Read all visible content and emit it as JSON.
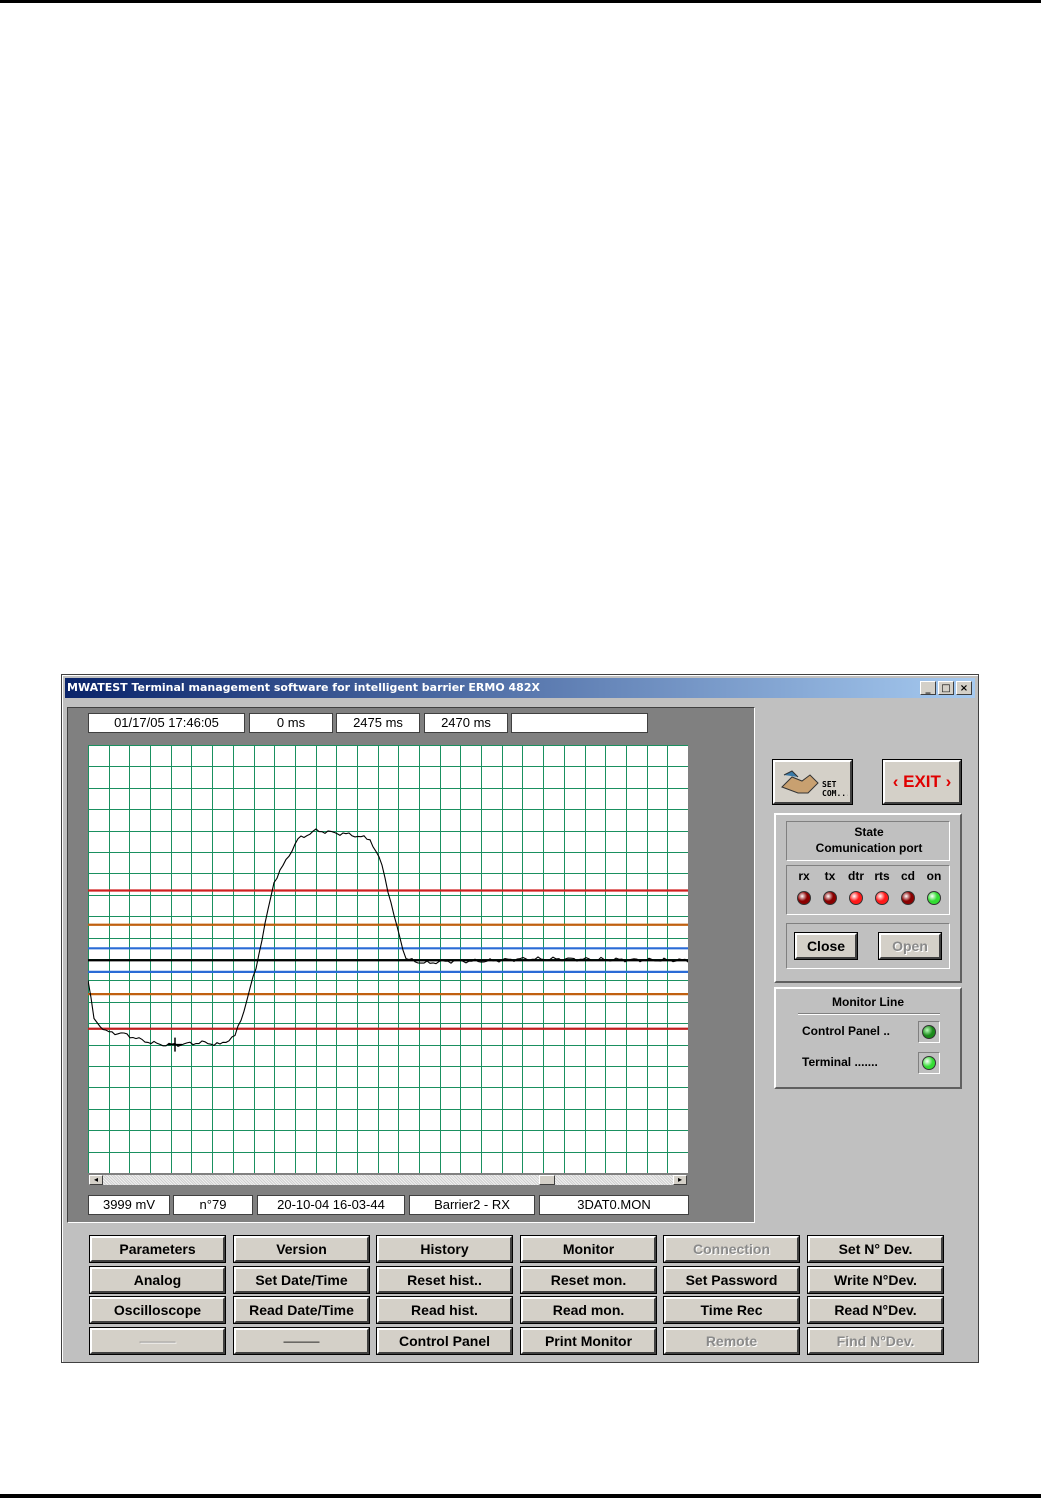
{
  "window": {
    "title": "MWATEST Terminal management software for intelligent barrier ERMO 482X",
    "controls": {
      "minimize": "_",
      "maximize": "□",
      "close": "×"
    }
  },
  "scope": {
    "top_fields": [
      "01/17/05 17:46:05",
      "0 ms",
      "2475 ms",
      "2470 ms",
      ""
    ],
    "bottom_fields": [
      "3999 mV",
      "n°79",
      "20-10-04 16-03-44",
      "Barrier2 - RX",
      "3DAT0.MON"
    ]
  },
  "chart_data": {
    "type": "line",
    "grid": true,
    "reference_lines": [
      {
        "color": "#d02020",
        "level": 0.66
      },
      {
        "color": "#c06010",
        "level": 0.58
      },
      {
        "color": "#2a6bd6",
        "level": 0.525
      },
      {
        "color": "#000000",
        "level": 0.497
      },
      {
        "color": "#2a6bd6",
        "level": 0.47
      },
      {
        "color": "#c06010",
        "level": 0.418
      },
      {
        "color": "#c02020",
        "level": 0.337
      }
    ],
    "signal": {
      "color": "#000000",
      "points": [
        [
          0.0,
          0.45
        ],
        [
          0.01,
          0.36
        ],
        [
          0.03,
          0.33
        ],
        [
          0.06,
          0.325
        ],
        [
          0.09,
          0.31
        ],
        [
          0.12,
          0.3
        ],
        [
          0.15,
          0.3
        ],
        [
          0.19,
          0.305
        ],
        [
          0.22,
          0.3
        ],
        [
          0.245,
          0.32
        ],
        [
          0.26,
          0.38
        ],
        [
          0.28,
          0.48
        ],
        [
          0.31,
          0.68
        ],
        [
          0.33,
          0.73
        ],
        [
          0.35,
          0.78
        ],
        [
          0.38,
          0.8
        ],
        [
          0.41,
          0.795
        ],
        [
          0.44,
          0.79
        ],
        [
          0.47,
          0.78
        ],
        [
          0.49,
          0.72
        ],
        [
          0.51,
          0.6
        ],
        [
          0.53,
          0.5
        ],
        [
          0.56,
          0.49
        ],
        [
          0.6,
          0.495
        ],
        [
          0.66,
          0.495
        ],
        [
          0.72,
          0.5
        ],
        [
          0.8,
          0.5
        ],
        [
          0.9,
          0.498
        ],
        [
          1.0,
          0.497
        ]
      ]
    },
    "cursor": {
      "x": 0.145,
      "y": 0.3
    }
  },
  "buttons": {
    "setcom_label": "SET COM...",
    "exit_label": "‹ EXIT ›",
    "grid": [
      [
        {
          "label": "Parameters",
          "enabled": true
        },
        {
          "label": "Version",
          "enabled": true
        },
        {
          "label": "History",
          "enabled": true
        },
        {
          "label": "Monitor",
          "enabled": true
        },
        {
          "label": "Connection",
          "enabled": false
        },
        {
          "label": "Set N° Dev.",
          "enabled": true
        }
      ],
      [
        {
          "label": "Analog",
          "enabled": true
        },
        {
          "label": "Set Date/Time",
          "enabled": true
        },
        {
          "label": "Reset hist..",
          "enabled": true
        },
        {
          "label": "Reset mon.",
          "enabled": true
        },
        {
          "label": "Set Password",
          "enabled": true
        },
        {
          "label": "Write N°Dev.",
          "enabled": true
        }
      ],
      [
        {
          "label": "Oscilloscope",
          "enabled": true
        },
        {
          "label": "Read Date/Time",
          "enabled": true
        },
        {
          "label": "Read hist.",
          "enabled": true
        },
        {
          "label": "Read mon.",
          "enabled": true
        },
        {
          "label": "Time Rec",
          "enabled": true
        },
        {
          "label": "Read N°Dev.",
          "enabled": true
        }
      ],
      [
        {
          "label": "———",
          "enabled": false
        },
        {
          "label": "———",
          "enabled": true
        },
        {
          "label": "Control Panel",
          "enabled": true
        },
        {
          "label": "Print Monitor",
          "enabled": true
        },
        {
          "label": "Remote",
          "enabled": false
        },
        {
          "label": "Find N°Dev.",
          "enabled": false
        }
      ]
    ]
  },
  "comm_panel": {
    "title_line1": "State",
    "title_line2": "Comunication port",
    "leds": [
      {
        "label": "rx",
        "color": "#8b0000"
      },
      {
        "label": "tx",
        "color": "#8b0000"
      },
      {
        "label": "dtr",
        "color": "#ff1a1a"
      },
      {
        "label": "rts",
        "color": "#ff1a1a"
      },
      {
        "label": "cd",
        "color": "#8b0000"
      },
      {
        "label": "on",
        "color": "#33dd33"
      }
    ],
    "close_label": "Close",
    "open_label": "Open"
  },
  "monitor_panel": {
    "title": "Monitor Line",
    "control_panel_label": "Control Panel ..",
    "control_panel_led": "#1a8a1a",
    "terminal_label": "Terminal  .......",
    "terminal_led": "#33dd33"
  }
}
